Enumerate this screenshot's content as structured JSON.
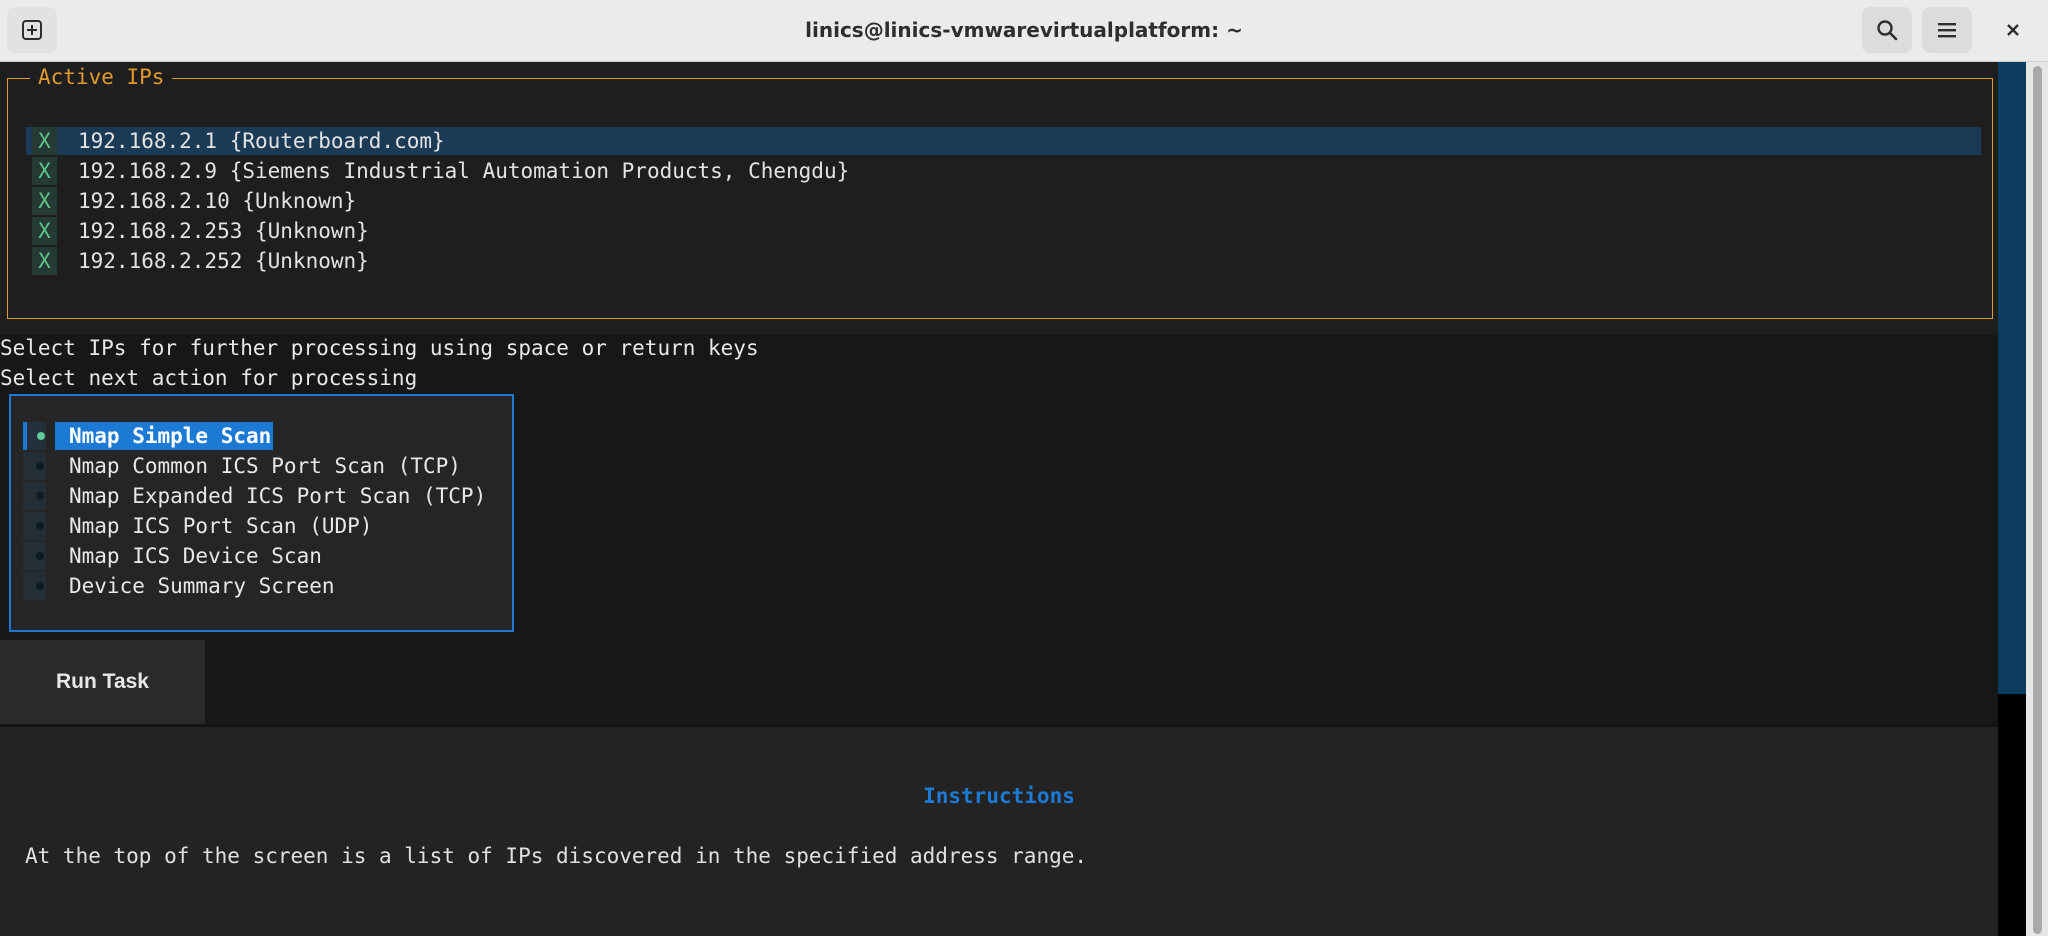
{
  "window": {
    "title": "linics@linics-vmwarevirtualplatform: ~"
  },
  "icons": {
    "new_tab": "new-tab-icon",
    "search": "search-icon",
    "menu": "hamburger-menu-icon",
    "close": "close-icon"
  },
  "ip_panel": {
    "title": "Active IPs",
    "items": [
      {
        "mark": "X",
        "text": "192.168.2.1 {Routerboard.com}",
        "highlighted": true
      },
      {
        "mark": "X",
        "text": "192.168.2.9 {Siemens Industrial Automation Products, Chengdu}",
        "highlighted": false
      },
      {
        "mark": "X",
        "text": "192.168.2.10 {Unknown}",
        "highlighted": false
      },
      {
        "mark": "X",
        "text": "192.168.2.253 {Unknown}",
        "highlighted": false
      },
      {
        "mark": "X",
        "text": "192.168.2.252 {Unknown}",
        "highlighted": false
      }
    ]
  },
  "prompts": {
    "select_ips": "Select IPs for further processing using space or return keys",
    "select_action": "Select next action for processing"
  },
  "actions": {
    "selected_index": 0,
    "items": [
      {
        "label": "Nmap Simple Scan"
      },
      {
        "label": "Nmap Common ICS Port Scan (TCP)"
      },
      {
        "label": "Nmap Expanded ICS Port Scan (TCP)"
      },
      {
        "label": "Nmap ICS Port Scan (UDP)"
      },
      {
        "label": "Nmap ICS Device Scan"
      },
      {
        "label": "Device Summary Screen"
      }
    ]
  },
  "run_button": {
    "label": "Run Task"
  },
  "instructions": {
    "title": "Instructions",
    "text": "At the top of the screen is a list of IPs discovered in the specified address range."
  },
  "colors": {
    "accent": "#1c7ad4",
    "panel_border": "#e09a2d",
    "highlight_row": "#1b3a56",
    "check_mark": "#5ec48a"
  }
}
